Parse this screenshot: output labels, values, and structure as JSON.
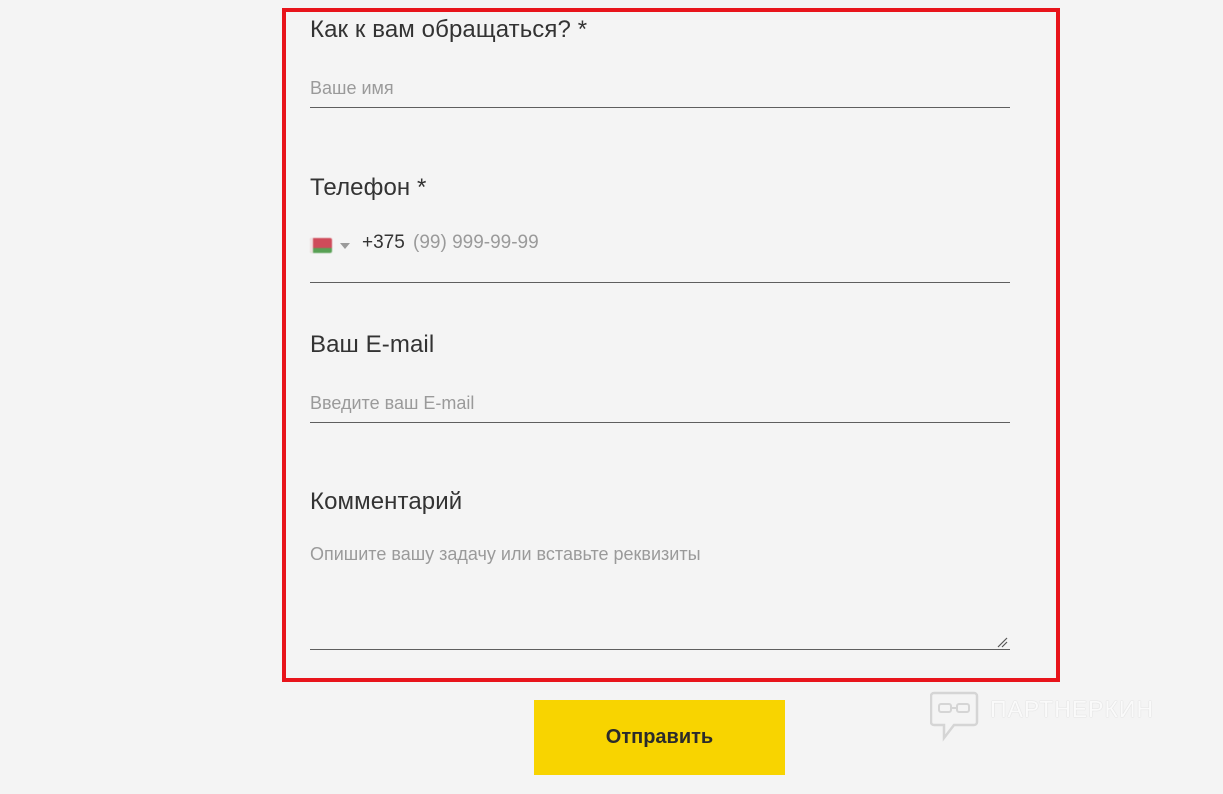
{
  "form": {
    "name": {
      "label": "Как к вам обращаться? *",
      "placeholder": "Ваше имя"
    },
    "phone": {
      "label": "Телефон *",
      "country_flag": "belarus-flag-icon",
      "dial_code": "+375",
      "mask": "(99) 999-99-99"
    },
    "email": {
      "label": "Ваш E-mail",
      "placeholder": "Введите ваш E-mail"
    },
    "comment": {
      "label": "Комментарий",
      "placeholder": "Опишите вашу задачу или вставьте реквизиты"
    },
    "submit_label": "Отправить"
  },
  "watermark": {
    "text": "ПАРТНЕРКИН",
    "icon": "chat-bubble-icon"
  },
  "colors": {
    "background": "#f4f4f4",
    "highlight_border": "#e8141b",
    "submit_background": "#f8d400",
    "placeholder": "#9a9a9a",
    "text": "#333333"
  }
}
